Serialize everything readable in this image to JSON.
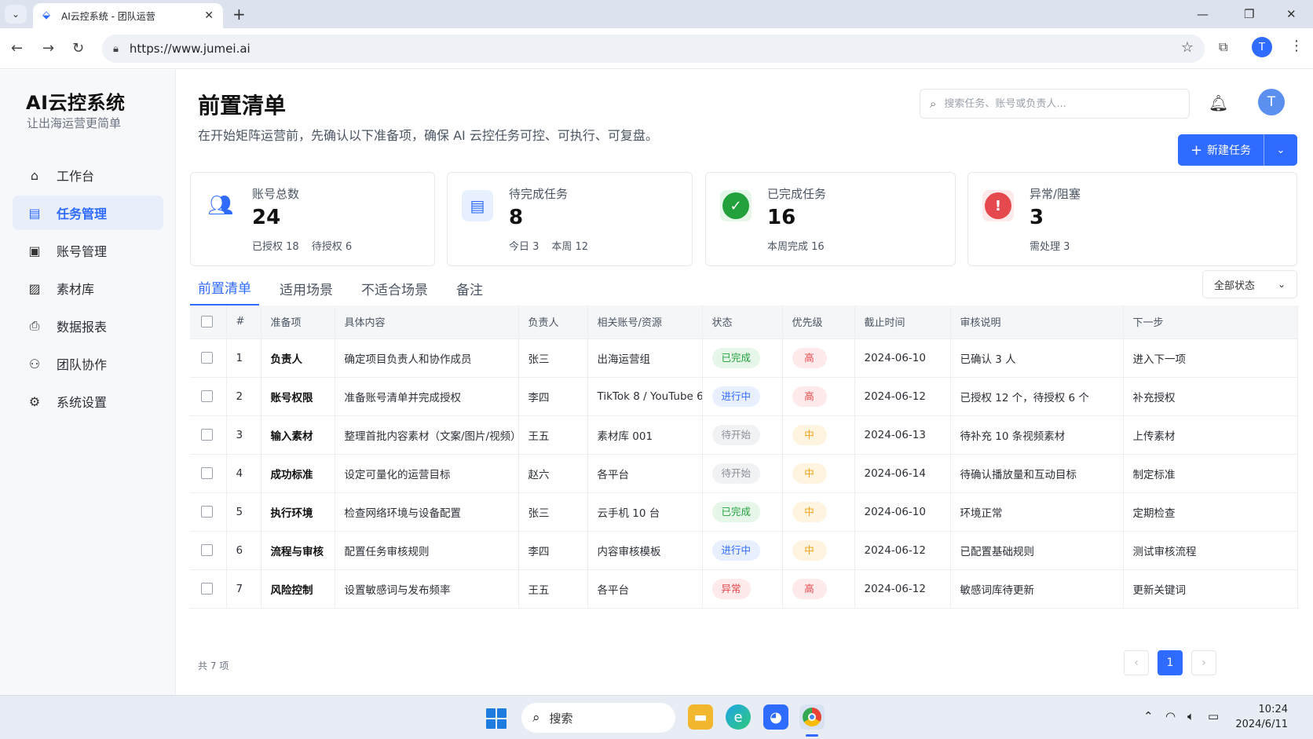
{
  "browser": {
    "tab_title": "AI云控系统 - 团队运营",
    "url": "https://www.jumei.ai",
    "profile_initial": "T"
  },
  "sidebar": {
    "brand": "AI云控系统",
    "tagline": "让出海运营更简单",
    "items": [
      {
        "label": "工作台",
        "icon": "home-icon",
        "active": false
      },
      {
        "label": "任务管理",
        "icon": "task-doc-icon",
        "active": true
      },
      {
        "label": "账号管理",
        "icon": "account-card-icon",
        "active": false
      },
      {
        "label": "素材库",
        "icon": "image-icon",
        "active": false
      },
      {
        "label": "数据报表",
        "icon": "report-icon",
        "active": false
      },
      {
        "label": "团队协作",
        "icon": "team-icon",
        "active": false
      },
      {
        "label": "系统设置",
        "icon": "gear-icon",
        "active": false
      }
    ]
  },
  "header": {
    "title": "前置清单",
    "description": "在开始矩阵运营前，先确认以下准备项，确保 AI 云控任务可控、可执行、可复盘。",
    "search_placeholder": "搜索任务、账号或负责人...",
    "avatar_initial": "T",
    "new_task_label": "新建任务"
  },
  "stats": [
    {
      "label": "账号总数",
      "value": "24",
      "sub": [
        "已授权 18",
        "待授权 6"
      ],
      "icon": "users-icon",
      "color": "#2f6bff"
    },
    {
      "label": "待完成任务",
      "value": "8",
      "sub": [
        "今日 3",
        "本周 12"
      ],
      "icon": "document-icon",
      "color": "#2f6bff"
    },
    {
      "label": "已完成任务",
      "value": "16",
      "sub": [
        "本周完成 16"
      ],
      "icon": "check-circle-icon",
      "color": "#22a03c"
    },
    {
      "label": "异常/阻塞",
      "value": "3",
      "sub": [
        "需处理 3"
      ],
      "icon": "alert-icon",
      "color": "#e5484d"
    }
  ],
  "tabs": [
    {
      "label": "前置清单",
      "active": true
    },
    {
      "label": "适用场景",
      "active": false
    },
    {
      "label": "不适合场景",
      "active": false
    },
    {
      "label": "备注",
      "active": false
    }
  ],
  "filter_label": "全部状态",
  "table": {
    "columns": [
      "#",
      "准备项",
      "具体内容",
      "负责人",
      "相关账号/资源",
      "状态",
      "优先级",
      "截止时间",
      "审核说明",
      "下一步"
    ],
    "rows": [
      {
        "no": "1",
        "item": "负责人",
        "content": "确定项目负责人和协作成员",
        "owner": "张三",
        "resource": "出海运营组",
        "status": "已完成",
        "status_kind": "done",
        "priority": "高",
        "priority_kind": "high",
        "deadline": "2024-06-10",
        "note": "已确认 3 人",
        "next": "进入下一项"
      },
      {
        "no": "2",
        "item": "账号权限",
        "content": "准备账号清单并完成授权",
        "owner": "李四",
        "resource": "TikTok 8 / YouTube 6",
        "status": "进行中",
        "status_kind": "doing",
        "priority": "高",
        "priority_kind": "high",
        "deadline": "2024-06-12",
        "note": "已授权 12 个，待授权 6 个",
        "next": "补充授权"
      },
      {
        "no": "3",
        "item": "输入素材",
        "content": "整理首批内容素材（文案/图片/视频）",
        "owner": "王五",
        "resource": "素材库 001",
        "status": "待开始",
        "status_kind": "todo",
        "priority": "中",
        "priority_kind": "mid",
        "deadline": "2024-06-13",
        "note": "待补充 10 条视频素材",
        "next": "上传素材"
      },
      {
        "no": "4",
        "item": "成功标准",
        "content": "设定可量化的运营目标",
        "owner": "赵六",
        "resource": "各平台",
        "status": "待开始",
        "status_kind": "todo",
        "priority": "中",
        "priority_kind": "mid",
        "deadline": "2024-06-14",
        "note": "待确认播放量和互动目标",
        "next": "制定标准"
      },
      {
        "no": "5",
        "item": "执行环境",
        "content": "检查网络环境与设备配置",
        "owner": "张三",
        "resource": "云手机 10 台",
        "status": "已完成",
        "status_kind": "done",
        "priority": "中",
        "priority_kind": "mid",
        "deadline": "2024-06-10",
        "note": "环境正常",
        "next": "定期检查"
      },
      {
        "no": "6",
        "item": "流程与审核",
        "content": "配置任务审核规则",
        "owner": "李四",
        "resource": "内容审核模板",
        "status": "进行中",
        "status_kind": "doing",
        "priority": "中",
        "priority_kind": "mid",
        "deadline": "2024-06-12",
        "note": "已配置基础规则",
        "next": "测试审核流程"
      },
      {
        "no": "7",
        "item": "风险控制",
        "content": "设置敏感词与发布频率",
        "owner": "王五",
        "resource": "各平台",
        "status": "异常",
        "status_kind": "err",
        "priority": "高",
        "priority_kind": "high",
        "deadline": "2024-06-12",
        "note": "敏感词库待更新",
        "next": "更新关键词"
      }
    ]
  },
  "footer": {
    "total": "共 7 项",
    "current_page": "1"
  },
  "taskbar": {
    "search_label": "搜索",
    "time": "10:24",
    "date": "2024/6/11"
  }
}
